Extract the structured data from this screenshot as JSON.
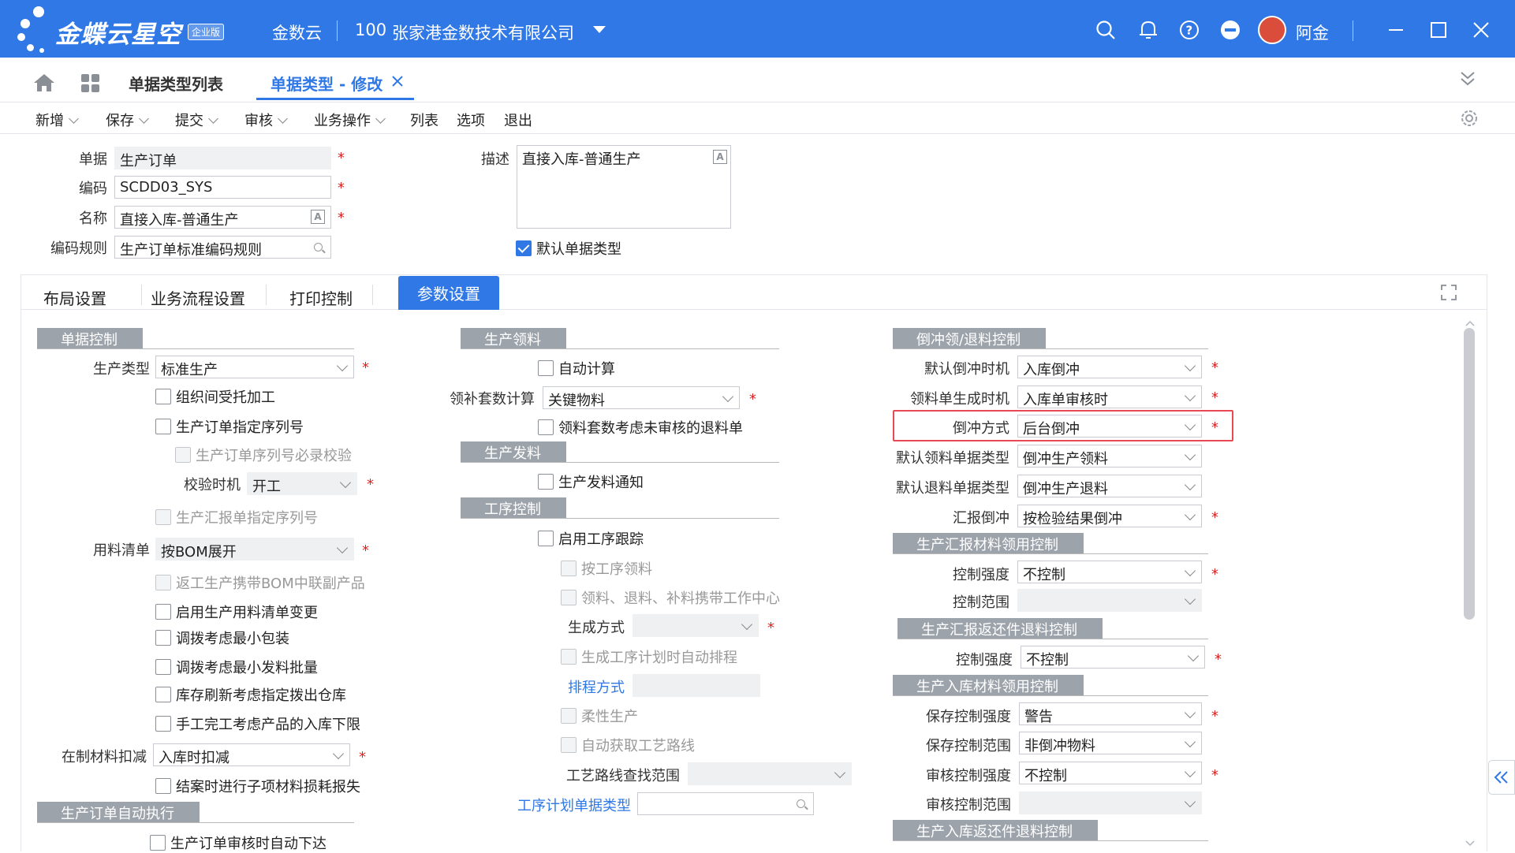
{
  "topbar": {
    "brand": "金蝶云星空",
    "edition": "企业版",
    "product": "金数云",
    "org_code": "100",
    "org_name": "张家港金数技术有限公司",
    "user": "阿金"
  },
  "tabs": [
    {
      "label": "单据类型列表"
    },
    {
      "label": "单据类型 - 修改"
    }
  ],
  "toolbar": [
    "新增",
    "保存",
    "提交",
    "审核",
    "业务操作",
    "列表",
    "选项",
    "退出"
  ],
  "header": {
    "bill_label": "单据",
    "bill_value": "生产订单",
    "code_label": "编码",
    "code_value": "SCDD03_SYS",
    "name_label": "名称",
    "name_value": "直接入库-普通生产",
    "rule_label": "编码规则",
    "rule_value": "生产订单标准编码规则",
    "desc_label": "描述",
    "desc_value": "直接入库-普通生产",
    "default_type_label": "默认单据类型"
  },
  "panel_tabs": [
    "布局设置",
    "业务流程设置",
    "打印控制",
    "参数设置"
  ],
  "col1": {
    "sec_bill_control": "单据控制",
    "prod_type_label": "生产类型",
    "prod_type_value": "标准生产",
    "cb_outsource": "组织间受托加工",
    "cb_seq": "生产订单指定序列号",
    "cb_seq_check": "生产订单序列号必录校验",
    "check_time_label": "校验时机",
    "check_time_value": "开工",
    "cb_report_seq": "生产汇报单指定序列号",
    "bom_label": "用料清单",
    "bom_value": "按BOM展开",
    "cb_rework": "返工生产携带BOM中联副产品",
    "cb_bom_change": "启用生产用料清单变更",
    "cb_min_pack": "调拨考虑最小包装",
    "cb_min_batch": "调拨考虑最小发料批量",
    "cb_stock_refresh": "库存刷新考虑指定拨出仓库",
    "cb_manual_finish": "手工完工考虑产品的入库下限",
    "wip_label": "在制材料扣减",
    "wip_value": "入库时扣减",
    "cb_closing": "结案时进行子项材料损耗报失",
    "sec_auto_exec": "生产订单自动执行",
    "cb_auto_issue": "生产订单审核时自动下达"
  },
  "col2": {
    "sec_pick": "生产领料",
    "cb_auto_calc": "自动计算",
    "kit_label": "领补套数计算",
    "kit_value": "关键物料",
    "cb_kit_unaudited": "领料套数考虑未审核的退料单",
    "sec_issue": "生产发料",
    "cb_issue_notice": "生产发料通知",
    "sec_operation": "工序控制",
    "cb_op_track": "启用工序跟踪",
    "cb_op_pick": "按工序领料",
    "cb_op_center": "领料、退料、补料携带工作中心",
    "gen_mode_label": "生成方式",
    "cb_auto_schedule": "生成工序计划时自动排程",
    "schedule_mode_label": "排程方式",
    "cb_flexible": "柔性生产",
    "cb_auto_route": "自动获取工艺路线",
    "route_range_label": "工艺路线查找范围",
    "op_plan_type_label": "工序计划单据类型"
  },
  "col3": {
    "sec_backflush": "倒冲领/退料控制",
    "default_time_label": "默认倒冲时机",
    "default_time_value": "入库倒冲",
    "gen_time_label": "领料单生成时机",
    "gen_time_value": "入库单审核时",
    "method_label": "倒冲方式",
    "method_value": "后台倒冲",
    "pick_type_label": "默认领料单据类型",
    "pick_type_value": "倒冲生产领料",
    "return_type_label": "默认退料单据类型",
    "return_type_value": "倒冲生产退料",
    "report_label": "汇报倒冲",
    "report_value": "按检验结果倒冲",
    "sec_report_material": "生产汇报材料领用控制",
    "rm_strength_label": "控制强度",
    "rm_strength_value": "不控制",
    "rm_range_label": "控制范围",
    "sec_report_rework": "生产汇报返还件退料控制",
    "rr_strength_label": "控制强度",
    "rr_strength_value": "不控制",
    "sec_instock_material": "生产入库材料领用控制",
    "save_strength_label": "保存控制强度",
    "save_strength_value": "警告",
    "save_range_label": "保存控制范围",
    "save_range_value": "非倒冲物料",
    "audit_strength_label": "审核控制强度",
    "audit_strength_value": "不控制",
    "audit_range_label": "审核控制范围",
    "sec_instock_rework": "生产入库返还件退料控制"
  }
}
